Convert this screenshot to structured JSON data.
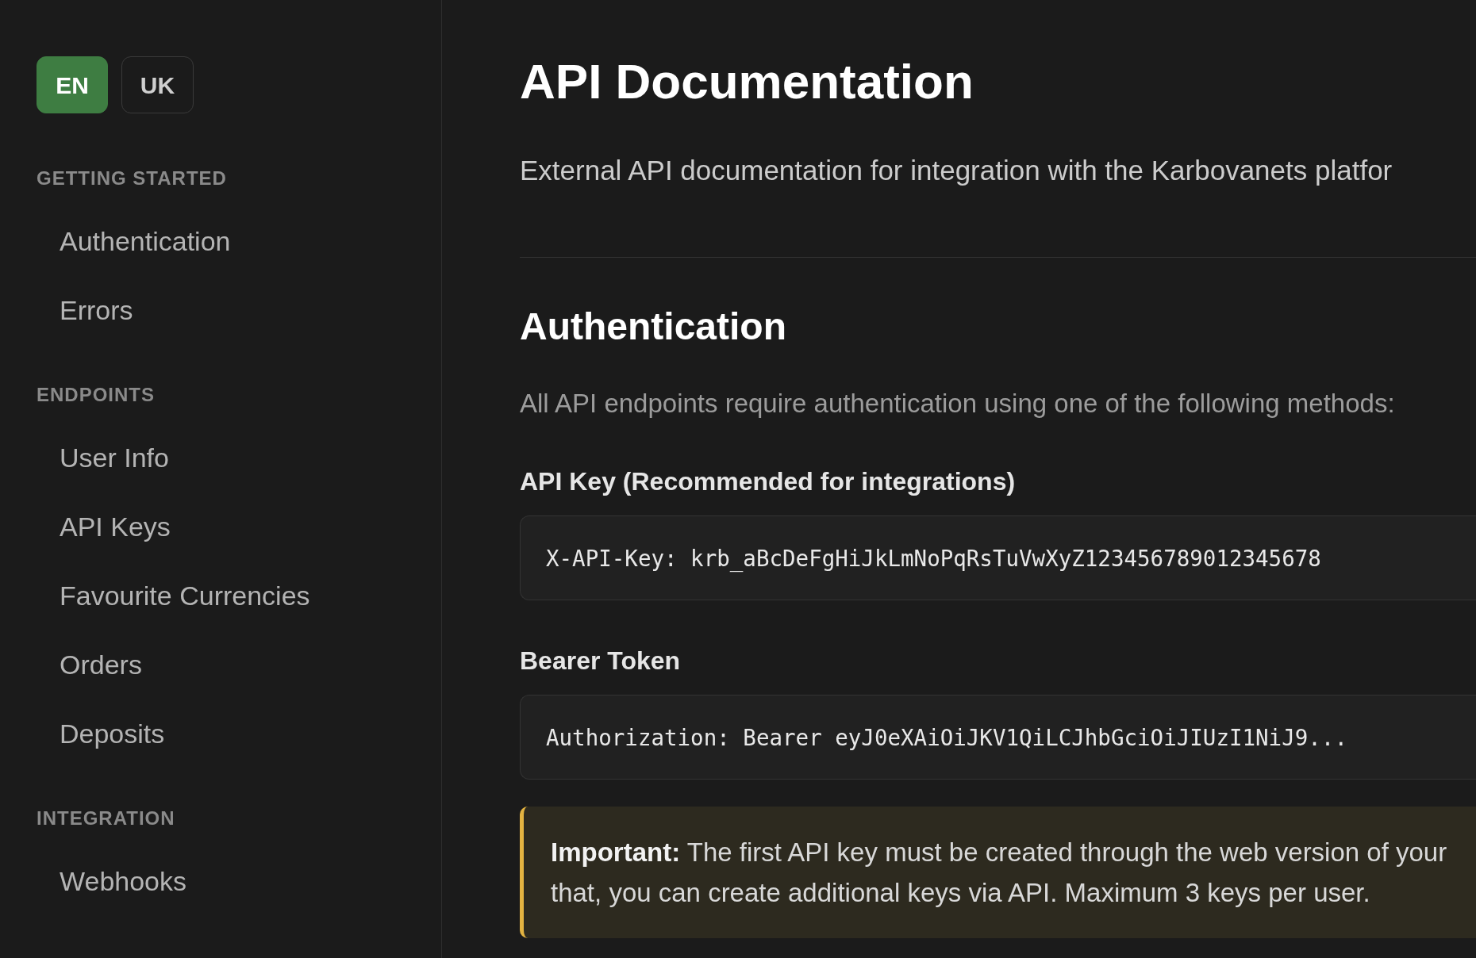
{
  "sidebar": {
    "languages": [
      {
        "label": "EN",
        "selected": true
      },
      {
        "label": "UK",
        "selected": false
      }
    ],
    "sections": [
      {
        "title": "GETTING STARTED",
        "items": [
          "Authentication",
          "Errors"
        ]
      },
      {
        "title": "ENDPOINTS",
        "items": [
          "User Info",
          "API Keys",
          "Favourite Currencies",
          "Orders",
          "Deposits"
        ]
      },
      {
        "title": "INTEGRATION",
        "items": [
          "Webhooks"
        ]
      }
    ]
  },
  "main": {
    "title": "API Documentation",
    "subtitle": "External API documentation for integration with the Karbovanets platfor",
    "section": {
      "heading": "Authentication",
      "intro": "All API endpoints require authentication using one of the following methods:",
      "methods": [
        {
          "label": "API Key (Recommended for integrations)",
          "code": "X-API-Key: krb_aBcDeFgHiJkLmNoPqRsTuVwXyZ123456789012345678"
        },
        {
          "label": "Bearer Token",
          "code": "Authorization: Bearer eyJ0eXAiOiJKV1QiLCJhbGciOiJIUzI1NiJ9..."
        }
      ],
      "callout": {
        "lines": [
          "**Important:** The first API key must be created through the web version of your",
          "that, you can create additional keys via API. Maximum 3 keys per user."
        ]
      }
    }
  }
}
